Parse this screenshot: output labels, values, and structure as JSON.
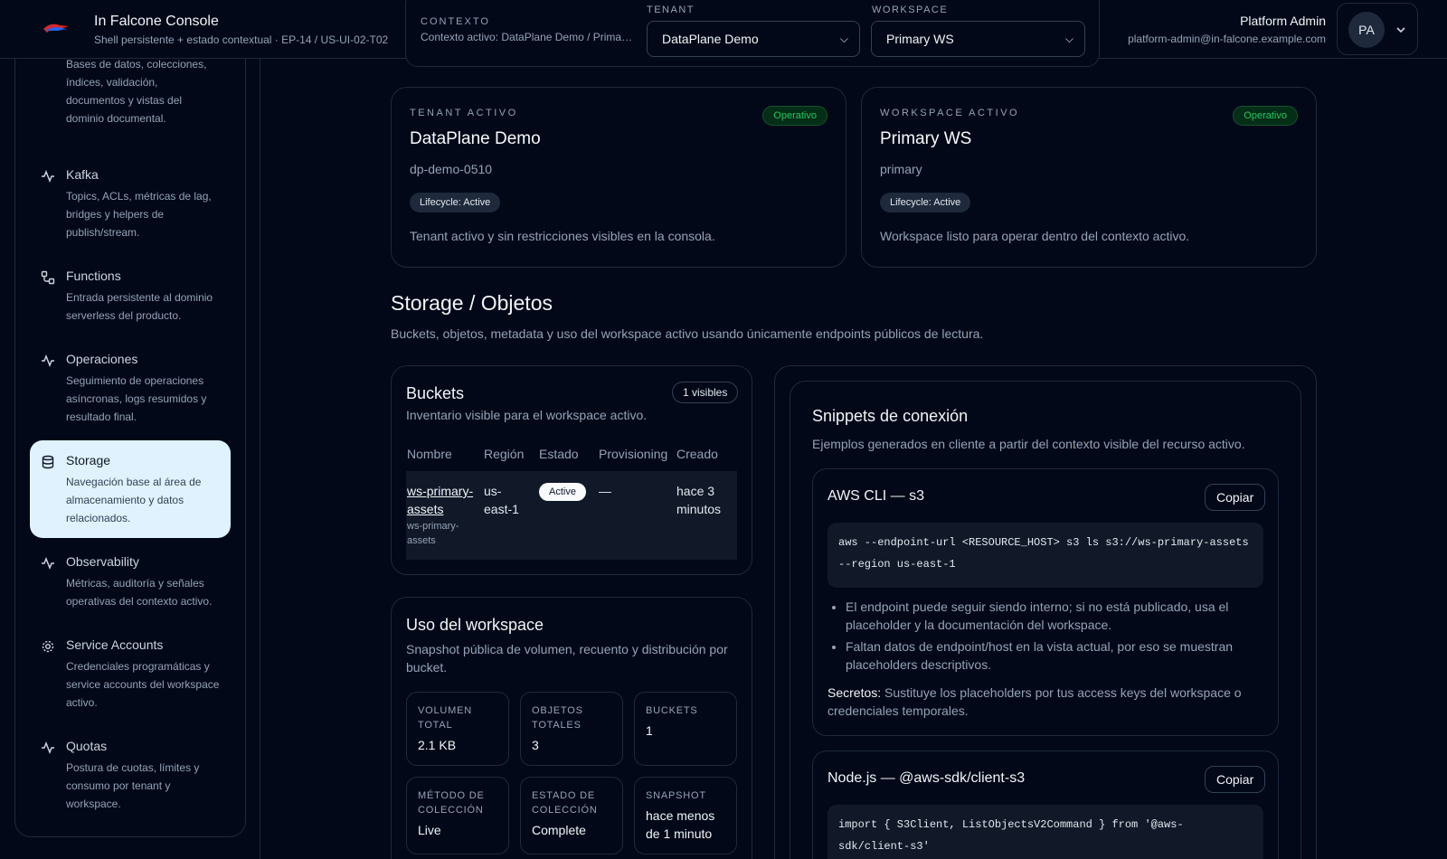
{
  "header": {
    "title": "In Falcone Console",
    "subtitle": "Shell persistente + estado contextual · EP-14 / US-UI-02-T02",
    "context_label": "CONTEXTO",
    "context_value": "Contexto activo: DataPlane Demo / Primary WS",
    "tenant_label": "TENANT",
    "tenant_value": "DataPlane Demo",
    "workspace_label": "WORKSPACE",
    "workspace_value": "Primary WS",
    "user_name": "Platform Admin",
    "user_email": "platform-admin@in-falcone.example.com",
    "avatar_initials": "PA"
  },
  "sidebar": {
    "items": [
      {
        "title": "",
        "desc": "Bases de datos, colecciones, índices, validación, documentos y vistas del dominio documental.",
        "icon": "activity-icon"
      },
      {
        "title": "Kafka",
        "desc": "Topics, ACLs, métricas de lag, bridges y helpers de publish/stream.",
        "icon": "activity-icon"
      },
      {
        "title": "Functions",
        "desc": "Entrada persistente al dominio serverless del producto.",
        "icon": "workflow-icon"
      },
      {
        "title": "Operaciones",
        "desc": "Seguimiento de operaciones asíncronas, logs resumidos y resultado final.",
        "icon": "activity-icon"
      },
      {
        "title": "Storage",
        "desc": "Navegación base al área de almacenamiento y datos relacionados.",
        "icon": "database-icon"
      },
      {
        "title": "Observability",
        "desc": "Métricas, auditoría y señales operativas del contexto activo.",
        "icon": "activity-icon"
      },
      {
        "title": "Service Accounts",
        "desc": "Credenciales programáticas y service accounts del workspace activo.",
        "icon": "gear-icon"
      },
      {
        "title": "Quotas",
        "desc": "Postura de cuotas, límites y consumo por tenant y workspace.",
        "icon": "activity-icon"
      }
    ]
  },
  "tenant_card": {
    "eyebrow": "TENANT ACTIVO",
    "status": "Operativo",
    "name": "DataPlane Demo",
    "slug": "dp-demo-0510",
    "lifecycle": "Lifecycle: Active",
    "desc": "Tenant activo y sin restricciones visibles en la consola."
  },
  "workspace_card": {
    "eyebrow": "WORKSPACE ACTIVO",
    "status": "Operativo",
    "name": "Primary WS",
    "slug": "primary",
    "lifecycle": "Lifecycle: Active",
    "desc": "Workspace listo para operar dentro del contexto activo."
  },
  "page": {
    "title": "Storage / Objetos",
    "lead": "Buckets, objetos, metadata y uso del workspace activo usando únicamente endpoints públicos de lectura."
  },
  "buckets": {
    "title": "Buckets",
    "subtitle": "Inventario visible para el workspace activo.",
    "count": "1 visibles",
    "columns": [
      "Nombre",
      "Región",
      "Estado",
      "Provisioning",
      "Creado"
    ],
    "rows": [
      {
        "name_l1": "ws-primary-",
        "name_l2": "assets",
        "name_sub_l1": "ws-primary-",
        "name_sub_l2": "assets",
        "region_l1": "us-",
        "region_l2": "east-1",
        "status": "Active",
        "provisioning": "—",
        "created_l1": "hace 3",
        "created_l2": "minutos"
      }
    ]
  },
  "usage": {
    "title": "Uso del workspace",
    "subtitle_l1": "Snapshot pública de volumen, recuento y distribución por",
    "subtitle_l2": "bucket.",
    "stats": [
      {
        "label_l1": "VOLUMEN",
        "label_l2": "TOTAL",
        "value_l1": "2.1 KB",
        "value_l2": ""
      },
      {
        "label_l1": "OBJETOS",
        "label_l2": "TOTALES",
        "value_l1": "3",
        "value_l2": ""
      },
      {
        "label_l1": "BUCKETS",
        "label_l2": "",
        "value_l1": "1",
        "value_l2": ""
      },
      {
        "label_l1": "MÉTODO DE",
        "label_l2": "COLECCIÓN",
        "value_l1": "Live",
        "value_l2": ""
      },
      {
        "label_l1": "ESTADO DE",
        "label_l2": "COLECCIÓN",
        "value_l1": "Complete",
        "value_l2": ""
      },
      {
        "label_l1": "SNAPSHOT",
        "label_l2": "",
        "value_l1": "hace menos",
        "value_l2": "de 1 minuto"
      }
    ]
  },
  "snippets": {
    "title": "Snippets de conexión",
    "subtitle": "Ejemplos generados en cliente a partir del contexto visible del recurso activo.",
    "copy_label": "Copiar",
    "aws": {
      "title": "AWS CLI — s3",
      "code": "aws --endpoint-url <RESOURCE_HOST> s3 ls s3://ws-primary-assets\n--region us-east-1",
      "bullet1": "El endpoint puede seguir siendo interno; si no está publicado, usa el placeholder y la documentación del workspace.",
      "bullet2": "Faltan datos de endpoint/host en la vista actual, por eso se muestran placeholders descriptivos.",
      "secret_label": "Secretos:",
      "secret_text": " Sustituye los placeholders por tus access keys del workspace o credenciales temporales."
    },
    "node": {
      "title": "Node.js — @aws-sdk/client-s3",
      "code": "import { S3Client, ListObjectsV2Command } from '@aws-\nsdk/client-s3'"
    }
  }
}
